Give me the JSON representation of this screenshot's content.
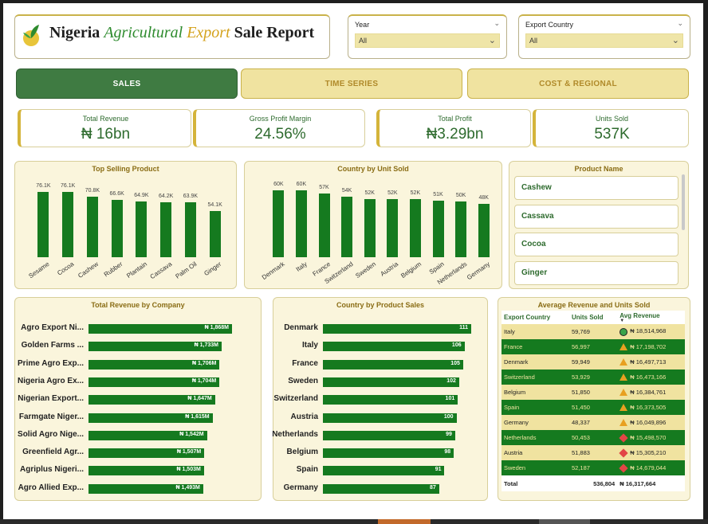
{
  "header": {
    "title_part1": "Nigeria",
    "title_part2": "Agricultural",
    "title_part3": "Export",
    "title_part4": "Sale Report"
  },
  "slicers": {
    "year": {
      "label": "Year",
      "value": "All"
    },
    "country": {
      "label": "Export Country",
      "value": "All"
    }
  },
  "tabs": [
    {
      "label": "SALES",
      "active": true
    },
    {
      "label": "TIME SERIES",
      "active": false
    },
    {
      "label": "COST & REGIONAL",
      "active": false
    }
  ],
  "kpis": [
    {
      "label": "Total Revenue",
      "value": "₦ 16bn"
    },
    {
      "label": "Gross Profit Margin",
      "value": "24.56%"
    },
    {
      "label": "Total Profit",
      "value": "₦3.29bn"
    },
    {
      "label": "Units Sold",
      "value": "537K"
    }
  ],
  "product_names": {
    "title": "Product Name",
    "items": [
      "Cashew",
      "Cassava",
      "Cocoa",
      "Ginger"
    ]
  },
  "chart_data": [
    {
      "type": "bar",
      "title": "Top Selling Product",
      "categories": [
        "Sesame",
        "Cocoa",
        "Cashew",
        "Rubber",
        "Plantain",
        "Cassava",
        "Palm Oil",
        "Ginger"
      ],
      "values": [
        76.1,
        76.1,
        70.8,
        66.6,
        64.9,
        64.2,
        63.9,
        54.1
      ],
      "labels": [
        "76.1K",
        "76.1K",
        "70.8K",
        "66.6K",
        "64.9K",
        "64.2K",
        "63.9K",
        "54.1K"
      ],
      "color": "#157a1f"
    },
    {
      "type": "bar",
      "title": "Country by Unit Sold",
      "categories": [
        "Denmark",
        "Italy",
        "France",
        "Switzerland",
        "Sweden",
        "Austria",
        "Belgium",
        "Spain",
        "Netherlands",
        "Germany"
      ],
      "values": [
        60,
        60,
        57,
        54,
        52,
        52,
        52,
        51,
        50,
        48
      ],
      "labels": [
        "60K",
        "60K",
        "57K",
        "54K",
        "52K",
        "52K",
        "52K",
        "51K",
        "50K",
        "48K"
      ],
      "color": "#157a1f"
    },
    {
      "type": "bar",
      "title": "Total Revenue by Company",
      "categories": [
        "Agro Export Ni...",
        "Golden Farms ...",
        "Prime Agro Exp...",
        "Nigeria Agro Ex...",
        "Nigerian Export...",
        "Farmgate Niger...",
        "Solid Agro Nige...",
        "Greenfield Agr...",
        "Agriplus Nigeri...",
        "Agro Allied Exp..."
      ],
      "values": [
        1868,
        1733,
        1706,
        1704,
        1647,
        1615,
        1542,
        1507,
        1503,
        1493
      ],
      "labels": [
        "₦ 1,868M",
        "₦ 1,733M",
        "₦ 1,706M",
        "₦ 1,704M",
        "₦ 1,647M",
        "₦ 1,615M",
        "₦ 1,542M",
        "₦ 1,507M",
        "₦ 1,503M",
        "₦ 1,493M"
      ],
      "color": "#157a1f"
    },
    {
      "type": "bar",
      "title": "Country by Product Sales",
      "categories": [
        "Denmark",
        "Italy",
        "France",
        "Sweden",
        "Switzerland",
        "Austria",
        "Netherlands",
        "Belgium",
        "Spain",
        "Germany"
      ],
      "values": [
        111,
        106,
        105,
        102,
        101,
        100,
        99,
        98,
        91,
        87
      ],
      "labels": [
        "111",
        "106",
        "105",
        "102",
        "101",
        "100",
        "99",
        "98",
        "91",
        "87"
      ],
      "color": "#157a1f"
    }
  ],
  "avg_table": {
    "title": "Average Revenue and Units Sold",
    "headers": [
      "Export Country",
      "Units Sold",
      "Avg Revenue"
    ],
    "rows": [
      {
        "country": "Italy",
        "units": "59,769",
        "icon": "circle",
        "avg": "₦ 18,514,968"
      },
      {
        "country": "France",
        "units": "56,997",
        "icon": "triangle",
        "avg": "₦ 17,198,702"
      },
      {
        "country": "Denmark",
        "units": "59,949",
        "icon": "triangle",
        "avg": "₦ 16,497,713"
      },
      {
        "country": "Switzerland",
        "units": "53,929",
        "icon": "triangle",
        "avg": "₦ 16,473,166"
      },
      {
        "country": "Belgium",
        "units": "51,850",
        "icon": "triangle",
        "avg": "₦ 16,384,761"
      },
      {
        "country": "Spain",
        "units": "51,450",
        "icon": "triangle",
        "avg": "₦ 16,373,505"
      },
      {
        "country": "Germany",
        "units": "48,337",
        "icon": "triangle",
        "avg": "₦ 16,049,896"
      },
      {
        "country": "Netherlands",
        "units": "50,453",
        "icon": "diamond",
        "avg": "₦ 15,498,570"
      },
      {
        "country": "Austria",
        "units": "51,883",
        "icon": "diamond",
        "avg": "₦ 15,305,210"
      },
      {
        "country": "Sweden",
        "units": "52,187",
        "icon": "diamond",
        "avg": "₦ 14,679,044"
      }
    ],
    "total": {
      "label": "Total",
      "units": "536,804",
      "avg": "₦ 16,317,664"
    }
  }
}
